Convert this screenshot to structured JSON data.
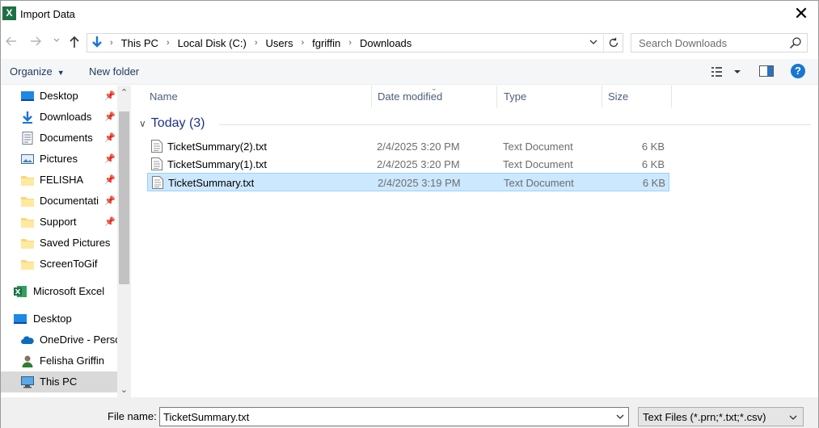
{
  "window": {
    "title": "Import Data",
    "app_icon_letter": "X",
    "close_glyph": "✕"
  },
  "address": {
    "crumbs": [
      "This PC",
      "Local Disk (C:)",
      "Users",
      "fgriffin",
      "Downloads"
    ],
    "search_placeholder": "Search Downloads"
  },
  "toolbar": {
    "organize_label": "Organize",
    "new_folder_label": "New folder",
    "help_label": "?"
  },
  "navpane": {
    "items": [
      {
        "label": "Desktop",
        "icon": "desktop-icon",
        "pinned": true
      },
      {
        "label": "Downloads",
        "icon": "download-arrow-icon",
        "pinned": true
      },
      {
        "label": "Documents",
        "icon": "documents-icon",
        "pinned": true
      },
      {
        "label": "Pictures",
        "icon": "pictures-icon",
        "pinned": true
      },
      {
        "label": "FELISHA",
        "icon": "folder-icon",
        "pinned": true
      },
      {
        "label": "Documentati",
        "icon": "folder-icon",
        "pinned": true
      },
      {
        "label": "Support",
        "icon": "folder-icon",
        "pinned": true
      },
      {
        "label": "Saved Pictures",
        "icon": "folder-icon",
        "pinned": false
      },
      {
        "label": "ScreenToGif",
        "icon": "folder-icon",
        "pinned": false
      },
      {
        "label": "Microsoft Excel",
        "icon": "excel-icon",
        "pinned": false
      },
      {
        "label": "Desktop",
        "icon": "desktop-icon",
        "pinned": false
      },
      {
        "label": "OneDrive - Persc",
        "icon": "onedrive-icon",
        "pinned": false
      },
      {
        "label": "Felisha Griffin",
        "icon": "user-icon",
        "pinned": false
      },
      {
        "label": "This PC",
        "icon": "this-pc-icon",
        "pinned": false,
        "selected": true
      }
    ]
  },
  "filelist": {
    "columns": {
      "name": "Name",
      "date": "Date modified",
      "type": "Type",
      "size": "Size"
    },
    "group_label": "Today (3)",
    "files": [
      {
        "name": "TicketSummary(2).txt",
        "date": "2/4/2025 3:20 PM",
        "type": "Text Document",
        "size": "6 KB",
        "selected": false
      },
      {
        "name": "TicketSummary(1).txt",
        "date": "2/4/2025 3:20 PM",
        "type": "Text Document",
        "size": "6 KB",
        "selected": false
      },
      {
        "name": "TicketSummary.txt",
        "date": "2/4/2025 3:19 PM",
        "type": "Text Document",
        "size": "6 KB",
        "selected": true
      }
    ]
  },
  "bottom": {
    "file_name_label": "File name:",
    "file_name_value": "TicketSummary.txt",
    "filter_value": "Text Files (*.prn;*.txt;*.csv)"
  },
  "colors": {
    "selection_bg": "#cce8ff",
    "selection_border": "#99d1ff",
    "nav_selected": "#d9d9d9",
    "group_header": "#1e3287",
    "excel_green": "#1d7044",
    "help_blue": "#1976d2"
  }
}
